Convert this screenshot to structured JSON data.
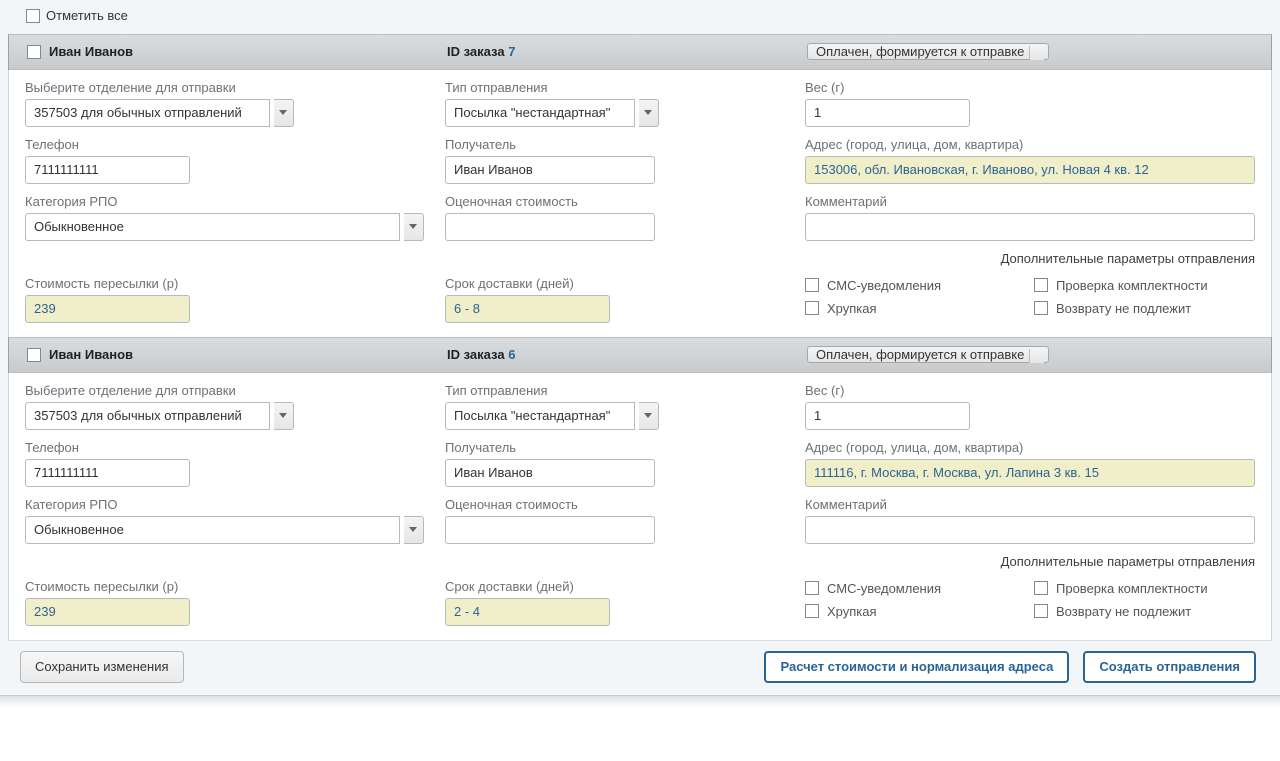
{
  "topbar": {
    "select_all": "Отметить все"
  },
  "labels": {
    "department": "Выберите отделение для отправки",
    "send_type": "Тип отправления",
    "weight": "Вес (г)",
    "phone": "Телефон",
    "recipient": "Получатель",
    "address": "Адрес (город, улица, дом, квартира)",
    "rpo": "Категория РПО",
    "est_value": "Оценочная стоимость",
    "comment": "Комментарий",
    "extras_title": "Дополнительные параметры отправления",
    "ship_cost": "Стоимость пересылки (р)",
    "delivery": "Срок доставки (дней)",
    "order_id_label": "ID заказа",
    "sms": "СМС-уведомления",
    "fragile": "Хрупкая",
    "complete_check": "Проверка комплектности",
    "no_return": "Возврату не подлежит"
  },
  "buttons": {
    "save": "Сохранить изменения",
    "calc": "Расчет стоимости и нормализация адреса",
    "create": "Создать отправления"
  },
  "orders": [
    {
      "customer": "Иван Иванов",
      "order_id": "7",
      "status": "Оплачен, формируется к отправке",
      "department": "357503 для обычных отправлений",
      "send_type": "Посылка \"нестандартная\"",
      "weight": "1",
      "phone": "7111111111",
      "recipient": "Иван Иванов",
      "address": "153006, обл. Ивановская, г. Иваново, ул. Новая 4 кв. 12",
      "rpo": "Обыкновенное",
      "est_value": "",
      "comment": "",
      "cost": "239",
      "delivery": "6 - 8"
    },
    {
      "customer": "Иван Иванов",
      "order_id": "6",
      "status": "Оплачен, формируется к отправке",
      "department": "357503 для обычных отправлений",
      "send_type": "Посылка \"нестандартная\"",
      "weight": "1",
      "phone": "7111111111",
      "recipient": "Иван Иванов",
      "address": "111116, г. Москва, г. Москва, ул. Лапина 3 кв. 15",
      "rpo": "Обыкновенное",
      "est_value": "",
      "comment": "",
      "cost": "239",
      "delivery": "2 - 4"
    }
  ]
}
